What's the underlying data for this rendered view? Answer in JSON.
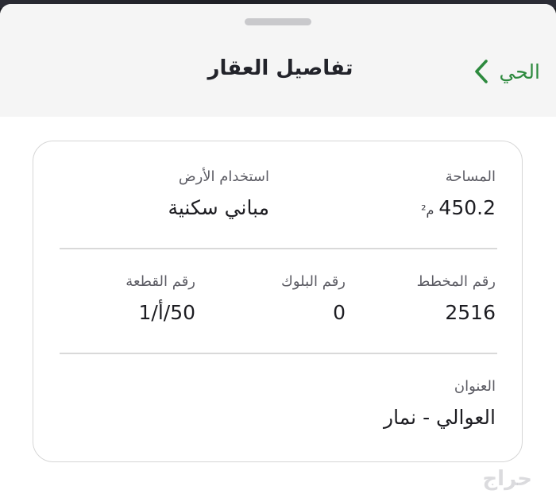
{
  "header": {
    "title": "تفاصيل العقار",
    "back_label": "الحي"
  },
  "property": {
    "area_label": "المساحة",
    "area_value": "450.2",
    "area_unit": "م²",
    "land_use_label": "استخدام الأرض",
    "land_use_value": "مباني سكنية",
    "plan_label": "رقم المخطط",
    "plan_value": "2516",
    "block_label": "رقم البلوك",
    "block_value": "0",
    "plot_label": "رقم القطعة",
    "plot_value": "50/أ/1",
    "address_label": "العنوان",
    "address_value": "العوالي - نمار"
  },
  "watermark": "حراج",
  "colors": {
    "accent": "#2d8a3e",
    "header_bg": "#f5f5f5"
  },
  "icons": {
    "back": "chevron-left-icon"
  }
}
